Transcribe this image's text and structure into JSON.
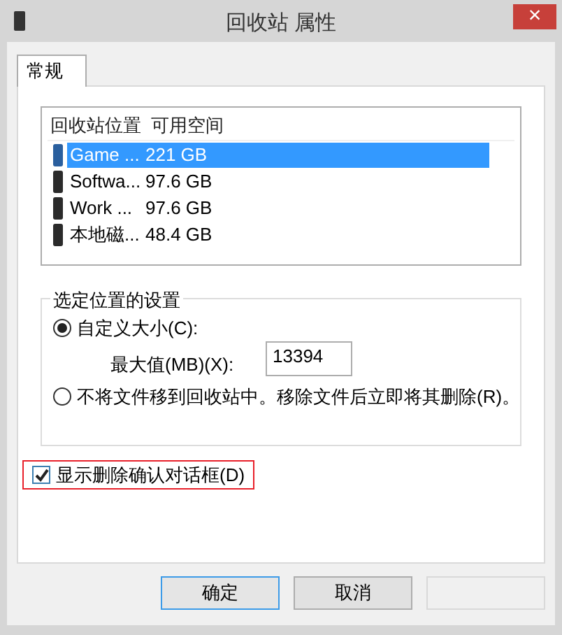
{
  "window": {
    "title": "回收站 属性",
    "close": "×"
  },
  "tabs": [
    {
      "label": "常规",
      "selected": true
    }
  ],
  "locations": {
    "columns": [
      "回收站位置",
      "可用空间"
    ],
    "rows": [
      {
        "name": "Game ...",
        "space": "221 GB",
        "selected": true
      },
      {
        "name": "Softwa...",
        "space": "97.6 GB",
        "selected": false
      },
      {
        "name": "Work ...",
        "space": "97.6 GB",
        "selected": false
      },
      {
        "name": "本地磁...",
        "space": "48.4 GB",
        "selected": false
      }
    ]
  },
  "settings": {
    "title": "选定位置的设置",
    "options": [
      {
        "label": "自定义大小(C):",
        "selected": true
      },
      {
        "label": "不将文件移到回收站中。移除文件后立即将其删除(R)。",
        "selected": false
      }
    ],
    "max_size": {
      "label": "最大值(MB)(X):",
      "value": "13394"
    }
  },
  "confirm": {
    "label": "显示删除确认对话框(D)",
    "checked": true,
    "highlighted": true
  },
  "buttons": [
    {
      "label": "确定",
      "default": true,
      "disabled": false
    },
    {
      "label": "取消",
      "default": false,
      "disabled": false
    },
    {
      "default": false,
      "disabled": true
    }
  ]
}
